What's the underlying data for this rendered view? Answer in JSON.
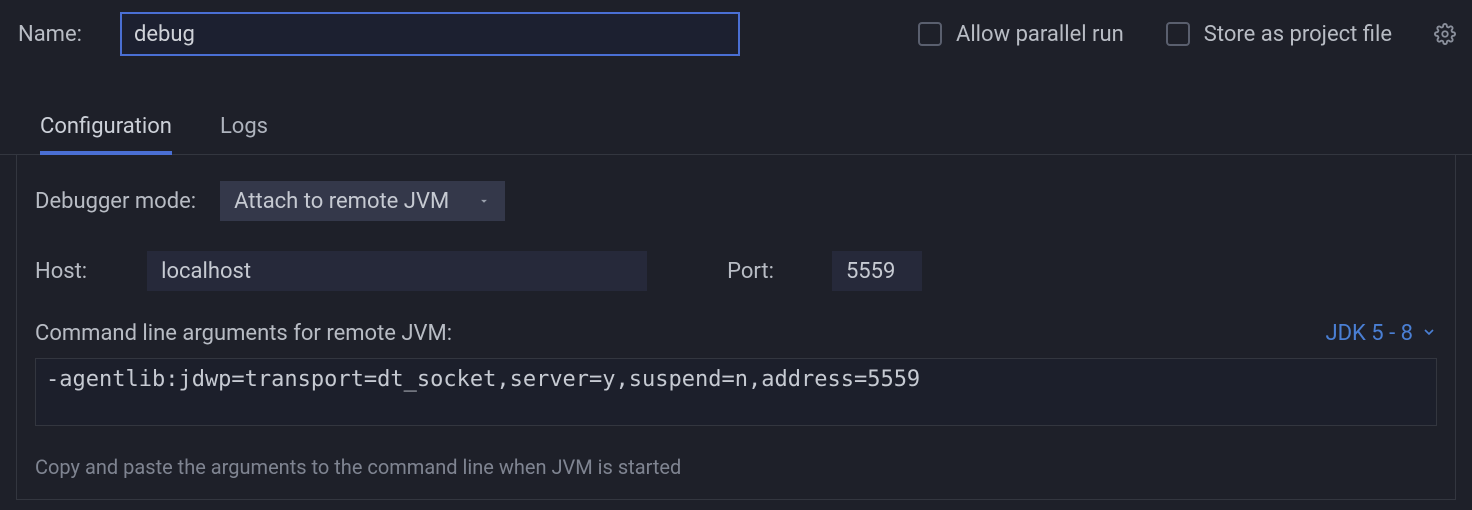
{
  "header": {
    "name_label": "Name:",
    "name_value": "debug",
    "allow_parallel_label": "Allow parallel run",
    "store_project_label": "Store as project file"
  },
  "tabs": {
    "configuration": "Configuration",
    "logs": "Logs"
  },
  "form": {
    "debugger_mode_label": "Debugger mode:",
    "debugger_mode_value": "Attach to remote JVM",
    "host_label": "Host:",
    "host_value": "localhost",
    "port_label": "Port:",
    "port_value": "5559",
    "cmdline_label": "Command line arguments for remote JVM:",
    "jdk_label": "JDK 5 - 8",
    "args_value": "-agentlib:jdwp=transport=dt_socket,server=y,suspend=n,address=5559",
    "hint": "Copy and paste the arguments to the command line when JVM is started"
  }
}
